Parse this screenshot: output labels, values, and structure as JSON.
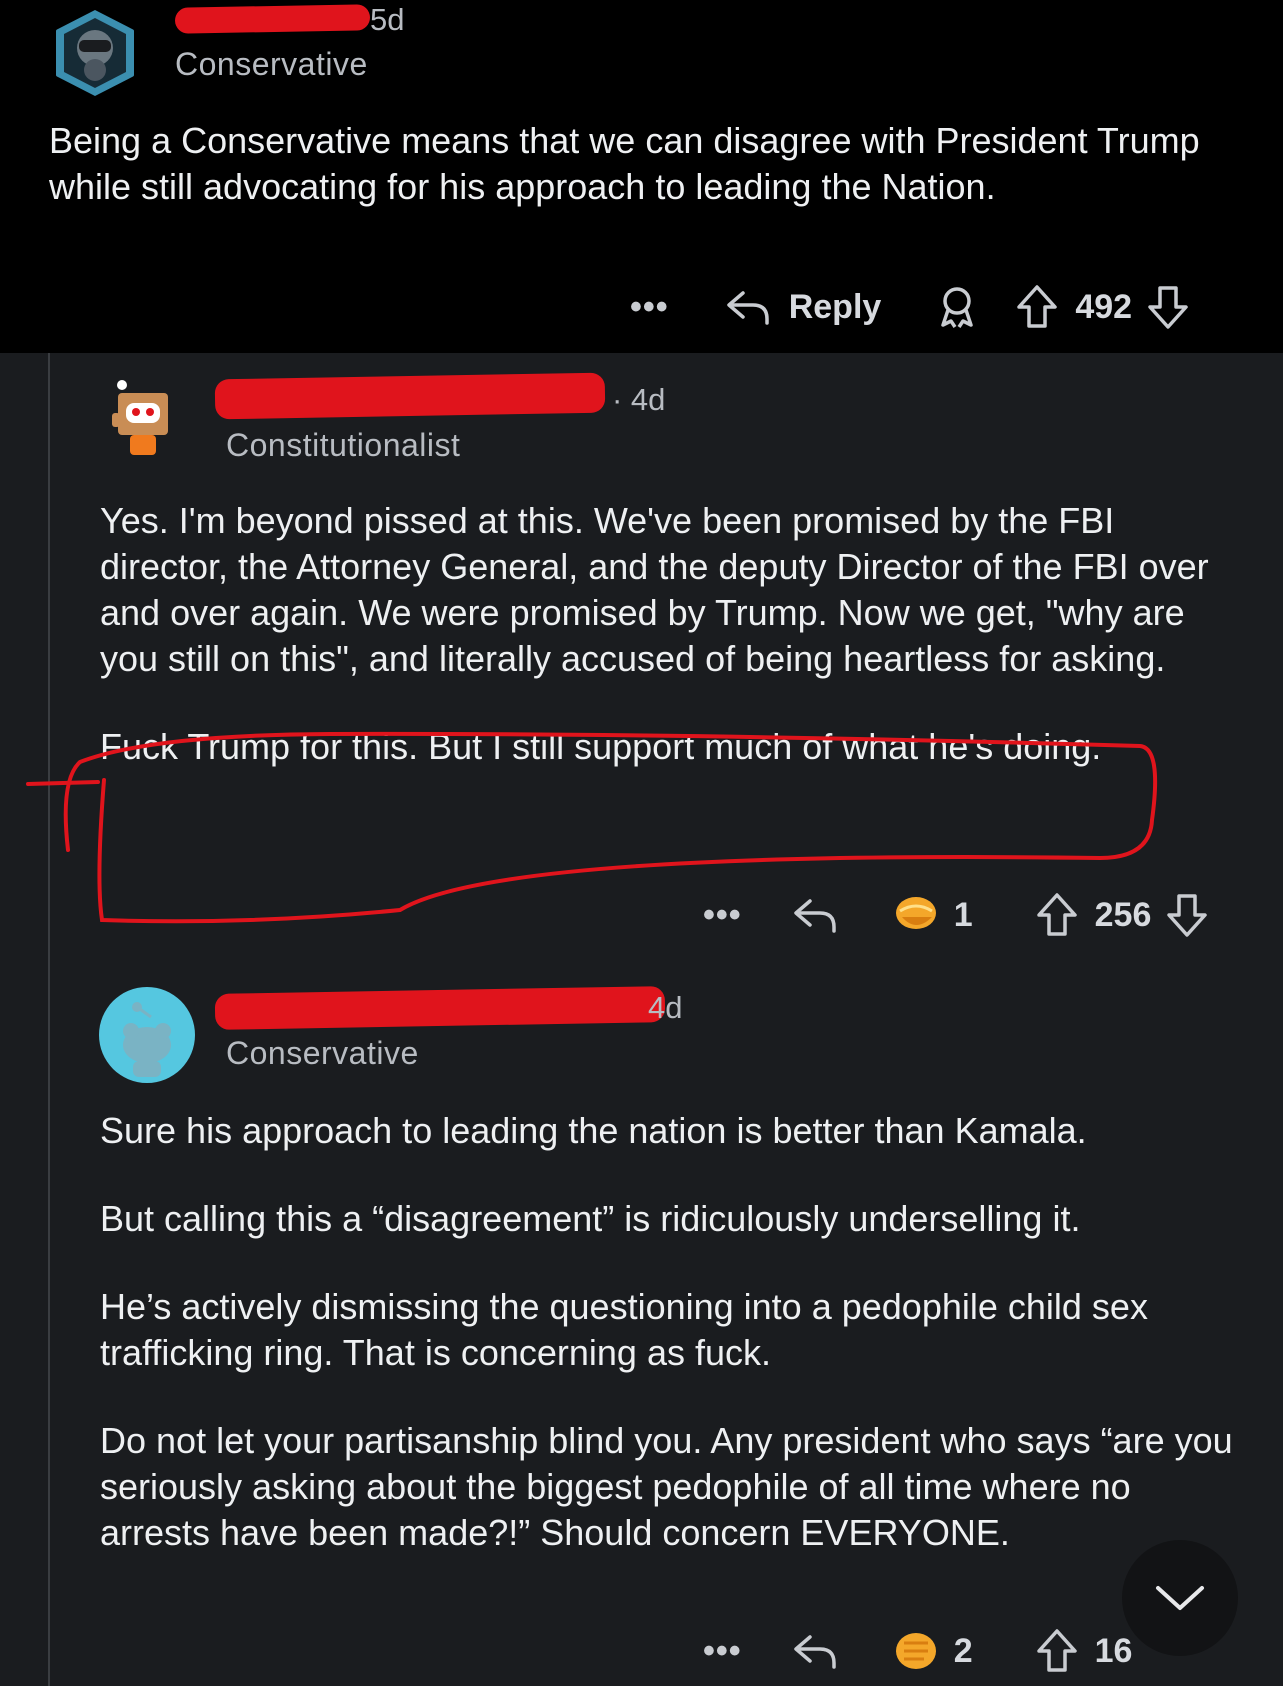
{
  "post": {
    "age": "5d",
    "flair": "Conservative",
    "body": "Being a Conservative means that we can disagree with President Trump while still advocating for his approach to leading the Nation.",
    "actions": {
      "more": "•••",
      "reply_label": "Reply",
      "vote_count": "492"
    }
  },
  "comment1": {
    "age": "· 4d",
    "flair": "Constitutionalist",
    "body_p1": "Yes. I'm beyond pissed at this. We've been promised by the FBI director, the Attorney General, and the deputy Director of the FBI over and over again. We were promised by Trump. Now we get, \"why are you still on this\", and literally accused of being heartless for asking.",
    "body_p2": "Fuck Trump for this. But I still support much of what he's doing.",
    "actions": {
      "more": "•••",
      "award_count": "1",
      "vote_count": "256"
    }
  },
  "comment2": {
    "age": "4d",
    "flair": "Conservative",
    "paragraphs": [
      "Sure his approach to leading the nation is better than Kamala.",
      "But calling this a “disagreement” is ridiculously underselling it.",
      "He’s actively dismissing the questioning into a pedophile child sex trafficking ring. That is concerning as fuck.",
      "Do not let your partisanship blind you. Any president who says “are you seriously asking about the biggest pedophile of all time where no arrests have been made?!” Should concern EVERYONE."
    ],
    "actions": {
      "more": "•••",
      "award_count": "2",
      "vote_count": "16"
    }
  },
  "colors": {
    "annotation_red": "#e0141c",
    "background": "#1a1c1f",
    "top_background": "#000000"
  },
  "icons": [
    "user-avatar-icon",
    "reply-arrow-icon",
    "award-icon",
    "upvote-arrow-icon",
    "downvote-arrow-icon",
    "chevron-down-icon"
  ]
}
